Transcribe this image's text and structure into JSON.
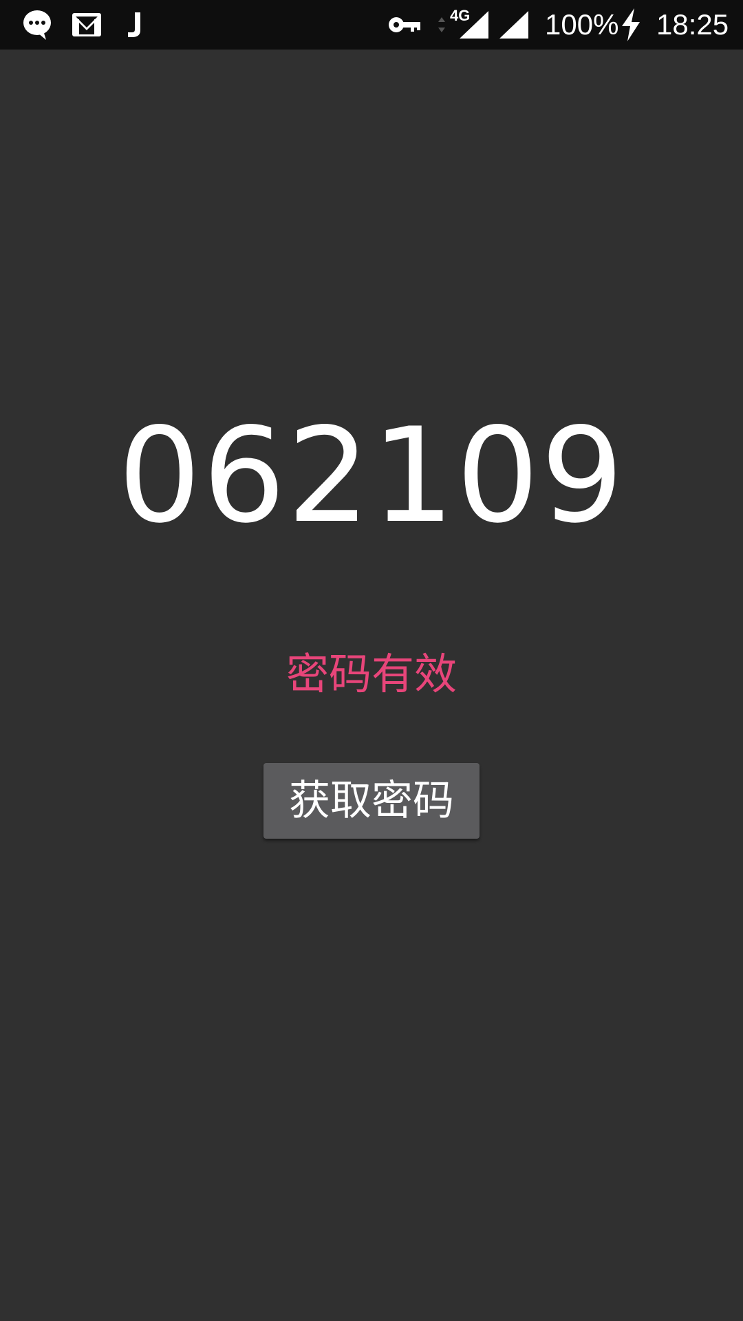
{
  "status_bar": {
    "battery": "100%",
    "time": "18:25",
    "network": "4G",
    "icons": [
      "chat-bubble-icon",
      "gmail-icon",
      "j-app-icon",
      "vpn-key-icon",
      "data-arrows-icon",
      "signal-icon",
      "signal-icon",
      "charging-bolt-icon"
    ]
  },
  "main": {
    "password_code": "062109",
    "status_text": "密码有效",
    "get_password_button": "获取密码"
  },
  "colors": {
    "background": "#303030",
    "status_bar": "#0e0e0e",
    "accent_status": "#e8457a",
    "button": "#5b5b5d"
  }
}
